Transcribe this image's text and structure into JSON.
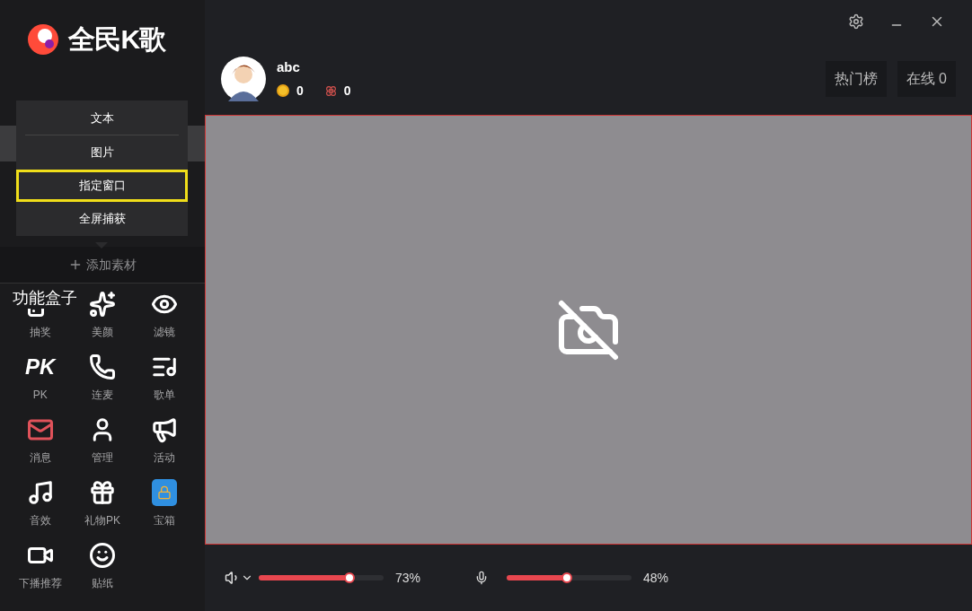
{
  "sidebar": {
    "logo_text": "全民K歌",
    "popup_menu": [
      {
        "label": "文本",
        "selected": false
      },
      {
        "label": "图片",
        "selected": false
      },
      {
        "label": "指定窗口",
        "selected": true
      },
      {
        "label": "全屏捕获",
        "selected": false
      }
    ],
    "add_material": "添加素材",
    "toolbox_title": "功能盒子",
    "tools": [
      {
        "label": "抽奖"
      },
      {
        "label": "美颜"
      },
      {
        "label": "滤镜"
      },
      {
        "label": "PK",
        "icon_text": "PK"
      },
      {
        "label": "连麦"
      },
      {
        "label": "歌单"
      },
      {
        "label": "消息"
      },
      {
        "label": "管理"
      },
      {
        "label": "活动"
      },
      {
        "label": "音效"
      },
      {
        "label": "礼物PK"
      },
      {
        "label": "宝箱"
      },
      {
        "label": "下播推荐"
      },
      {
        "label": "贴纸"
      }
    ]
  },
  "header": {
    "username": "abc",
    "coins": "0",
    "flowers": "0",
    "buttons": [
      "热门榜",
      "在线 0"
    ]
  },
  "controls": {
    "speaker": {
      "level": 0.73,
      "reading": "73%"
    },
    "mic": {
      "level": 0.48,
      "reading": "48%"
    }
  }
}
